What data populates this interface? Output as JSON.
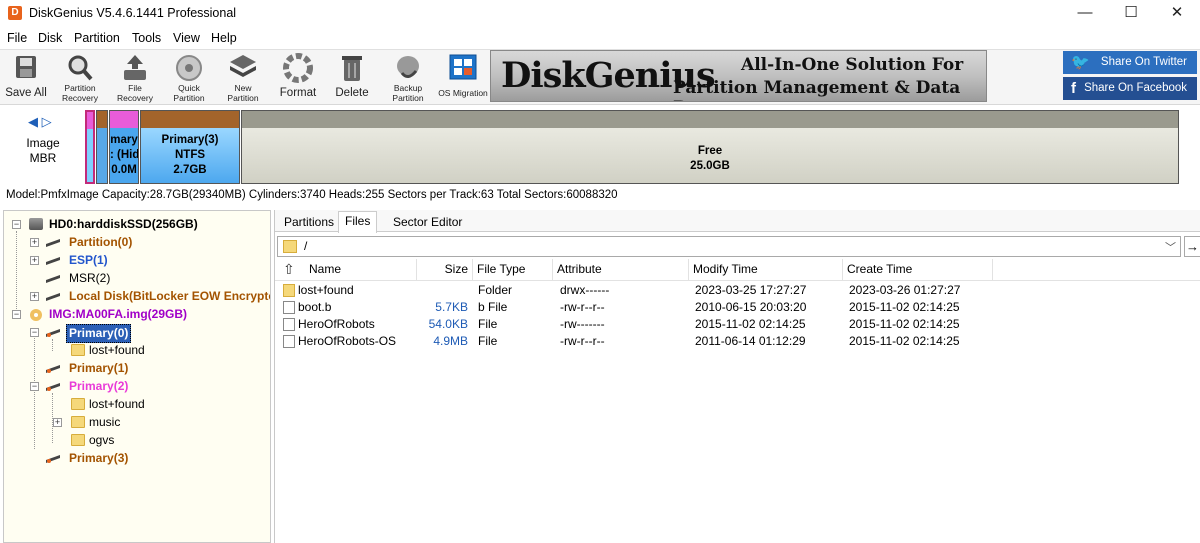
{
  "window": {
    "title": "DiskGenius V5.4.6.1441 Professional",
    "logo_letter": "D",
    "minimize": "—",
    "maximize": "☐",
    "close": "✕"
  },
  "menu": [
    "File",
    "Disk",
    "Partition",
    "Tools",
    "View",
    "Help"
  ],
  "toolbar": {
    "save_all": "Save All",
    "partition_recovery": [
      "Partition",
      "Recovery"
    ],
    "file_recovery": [
      "File",
      "Recovery"
    ],
    "quick_partition": [
      "Quick",
      "Partition"
    ],
    "new_partition": [
      "New",
      "Partition"
    ],
    "format": "Format",
    "delete": "Delete",
    "backup_partition": [
      "Backup",
      "Partition"
    ],
    "os_migration": "OS Migration"
  },
  "banner": {
    "logo": "DiskGenius",
    "line1": "All-In-One Solution For",
    "line2": "Partition Management & Data Recovery"
  },
  "share": {
    "twitter": "Share On Twitter",
    "facebook": "Share On Facebook",
    "twitter_icon": "🐦",
    "facebook_icon": "f"
  },
  "disk_nav": {
    "arrows": "◀ ▷",
    "label1": "Image",
    "label2": "MBR"
  },
  "disk_segments": {
    "seg3_line1": "mary",
    "seg3_line2": ": (Hid",
    "seg3_line3": "0.0M",
    "primary3_name": "Primary(3)",
    "primary3_fs": "NTFS",
    "primary3_size": "2.7GB",
    "free_name": "Free",
    "free_size": "25.0GB",
    "colors": {
      "pink": "#e85cd9",
      "brown": "#a3642b",
      "blue": "#4aa6ee",
      "free": "#dcdcd0"
    }
  },
  "disk_info": "Model:PmfxImage  Capacity:28.7GB(29340MB)  Cylinders:3740  Heads:255  Sectors per Track:63  Total Sectors:60088320",
  "tree": {
    "hd0": "HD0:harddiskSSD(256GB)",
    "partition0": "Partition(0)",
    "esp1": "ESP(1)",
    "msr2": "MSR(2)",
    "localdisk": "Local Disk(BitLocker EOW Encrypted)",
    "img": "IMG:MA00FA.img(29GB)",
    "primary0": "Primary(0)",
    "lostfound0": "lost+found",
    "primary1": "Primary(1)",
    "primary2": "Primary(2)",
    "lostfound2": "lost+found",
    "music": "music",
    "ogvs": "ogvs",
    "primary3": "Primary(3)",
    "plus": "+",
    "minus": "−"
  },
  "tabs": [
    "Partitions",
    "Files",
    "Sector Editor"
  ],
  "path": {
    "value": "/",
    "dropdown": "﹀",
    "go": "→"
  },
  "columns": {
    "up": "⇧",
    "name": "Name",
    "size": "Size",
    "file_type": "File Type",
    "attribute": "Attribute",
    "modify_time": "Modify Time",
    "create_time": "Create Time"
  },
  "files": [
    {
      "name": "lost+found",
      "size": "",
      "type": "Folder",
      "attr": "drwx------",
      "modified": "2023-03-25 17:27:27",
      "created": "2023-03-26 01:27:27",
      "icon": "folder-icon"
    },
    {
      "name": "boot.b",
      "size": "5.7KB",
      "type": "b File",
      "attr": "-rw-r--r--",
      "modified": "2010-06-15 20:03:20",
      "created": "2015-11-02 02:14:25",
      "icon": "file-icon"
    },
    {
      "name": "HeroOfRobots",
      "size": "54.0KB",
      "type": "File",
      "attr": "-rw-------",
      "modified": "2015-11-02 02:14:25",
      "created": "2015-11-02 02:14:25",
      "icon": "file-icon"
    },
    {
      "name": "HeroOfRobots-OS",
      "size": "4.9MB",
      "type": "File",
      "attr": "-rw-r--r--",
      "modified": "2011-06-14 01:12:29",
      "created": "2015-11-02 02:14:25",
      "icon": "file-icon"
    }
  ]
}
